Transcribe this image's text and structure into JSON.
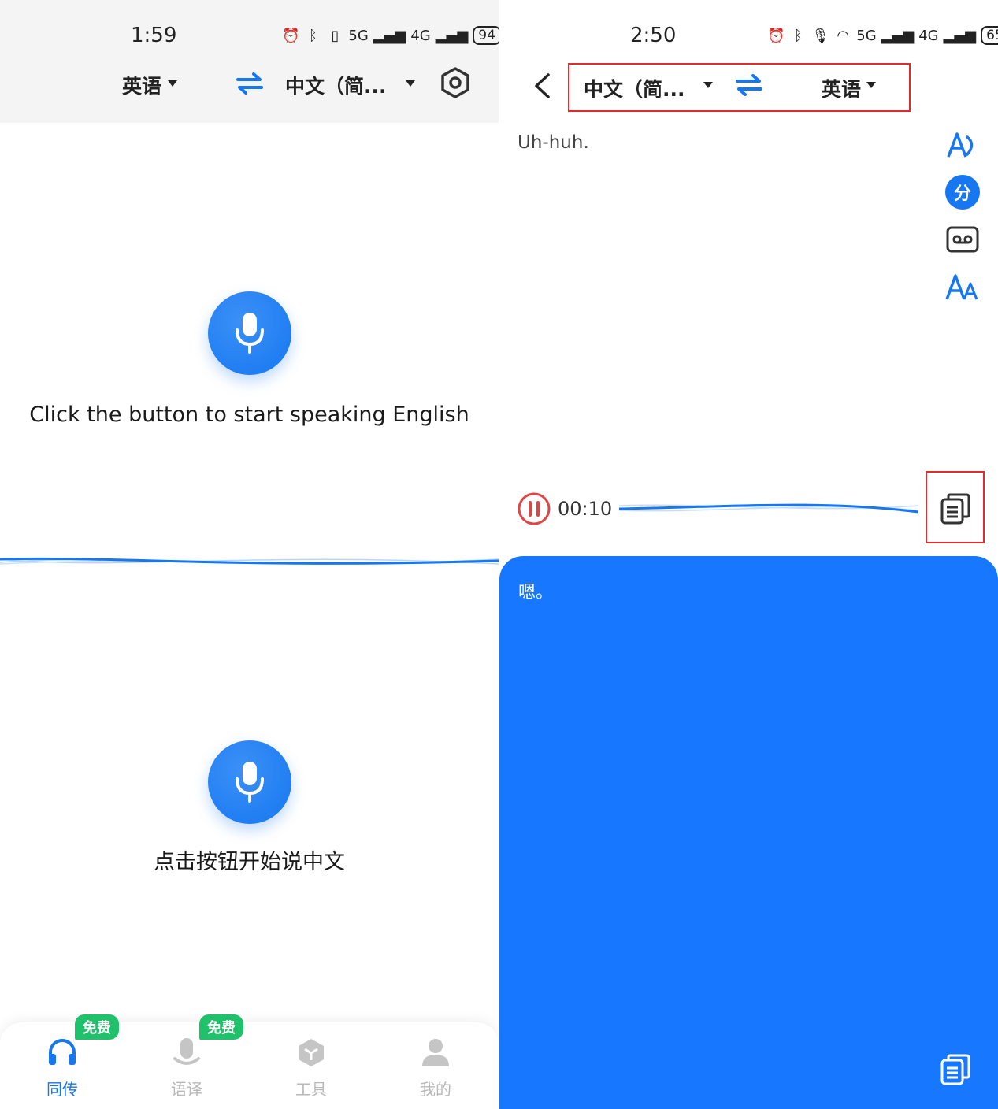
{
  "left": {
    "status": {
      "time": "1:59",
      "battery": "94",
      "net1": "5G",
      "net2": "4G"
    },
    "header": {
      "source_lang": "英语",
      "target_lang": "中文（简..."
    },
    "prompt_english": "Click the button to start speaking English",
    "prompt_chinese": "点击按钮开始说中文",
    "nav": {
      "items": [
        {
          "label": "同传",
          "badge": "免费",
          "active": true
        },
        {
          "label": "语译",
          "badge": "免费",
          "active": false
        },
        {
          "label": "工具",
          "badge": "",
          "active": false
        },
        {
          "label": "我的",
          "badge": "",
          "active": false
        }
      ]
    }
  },
  "right": {
    "status": {
      "time": "2:50",
      "battery": "65",
      "net1": "5G",
      "net2": "4G"
    },
    "header": {
      "source_lang": "中文（简...",
      "target_lang": "英语"
    },
    "source_text": "Uh-huh.",
    "side_tools": {
      "translate_glyph": "分"
    },
    "recording": {
      "timer": "00:10"
    },
    "target_text": "嗯。"
  },
  "colors": {
    "accent": "#1677f0",
    "panel": "#1777fe",
    "badge": "#1fc16b",
    "highlight": "#e32b2b",
    "pause": "#e04444"
  }
}
